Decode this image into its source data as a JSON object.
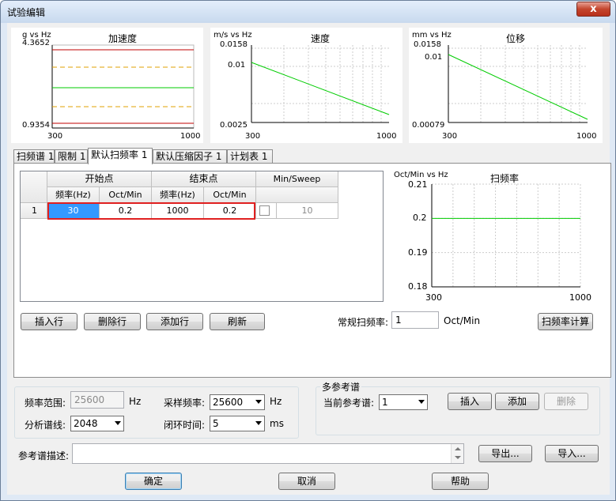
{
  "window": {
    "title": "试验编辑",
    "close_glyph": "x"
  },
  "charts": [
    {
      "id": "accel",
      "title": "加速度",
      "unit": "g vs Hz",
      "ymax_label": "4.3652",
      "ymin_label": "0.9354",
      "xmin_label": "300",
      "xmax_label": "1000"
    },
    {
      "id": "vel",
      "title": "速度",
      "unit": "m/s vs Hz",
      "ymax_label": "0.0158",
      "ymid_label": "0.01",
      "ymin_label": "0.0025",
      "xmin_label": "300",
      "xmax_label": "1000"
    },
    {
      "id": "disp",
      "title": "位移",
      "unit": "mm vs Hz",
      "ymax_label": "0.0158",
      "ymid_label": "0.01",
      "ymin_label": "0.00079",
      "xmin_label": "300",
      "xmax_label": "1000"
    }
  ],
  "tabs": [
    "扫频谱 1",
    "限制 1",
    "默认扫频率 1",
    "默认压缩因子 1",
    "计划表 1"
  ],
  "active_tab": 2,
  "table": {
    "group_headers": [
      "开始点",
      "结束点",
      "Min/Sweep"
    ],
    "sub_headers": [
      "频率(Hz)",
      "Oct/Min",
      "频率(Hz)",
      "Oct/Min"
    ],
    "rows": [
      {
        "index": "1",
        "start_freq": "30",
        "start_oct": "0.2",
        "end_freq": "1000",
        "end_oct": "0.2",
        "min_sweep": "10"
      }
    ]
  },
  "sweep_chart": {
    "title": "扫频率",
    "unit": "Oct/Min vs Hz",
    "y_labels": [
      "0.21",
      "0.2",
      "0.19",
      "0.18"
    ],
    "xmin_label": "300",
    "xmax_label": "1000",
    "chart_data": {
      "type": "line",
      "x": [
        300,
        1000
      ],
      "series": [
        {
          "values": [
            0.2,
            0.2
          ]
        }
      ],
      "xlim": [
        300,
        1000
      ],
      "ylim": [
        0.18,
        0.21
      ],
      "grid": true,
      "line_color": "#00cc00"
    }
  },
  "row_buttons": [
    "插入行",
    "删除行",
    "添加行",
    "刷新"
  ],
  "rate": {
    "label": "常规扫频率:",
    "value": "1",
    "unit": "Oct/Min",
    "calc_button": "扫频率计算"
  },
  "settings": {
    "freq_range_label": "频率范围:",
    "freq_range_value": "25600",
    "freq_range_unit": "Hz",
    "lines_label": "分析谱线:",
    "lines_value": "2048",
    "sample_label": "采样频率:",
    "sample_value": "25600",
    "sample_unit": "Hz",
    "loop_label": "闭环时间:",
    "loop_value": "5",
    "loop_unit": "ms"
  },
  "multi_ref": {
    "title": "多参考谱",
    "current_label": "当前参考谱:",
    "current_value": "1",
    "insert": "插入",
    "add": "添加",
    "delete": "删除"
  },
  "desc": {
    "label": "参考谱描述:",
    "value": "",
    "export": "导出...",
    "import": "导入..."
  },
  "footer": {
    "ok": "确定",
    "cancel": "取消",
    "help": "帮助"
  }
}
